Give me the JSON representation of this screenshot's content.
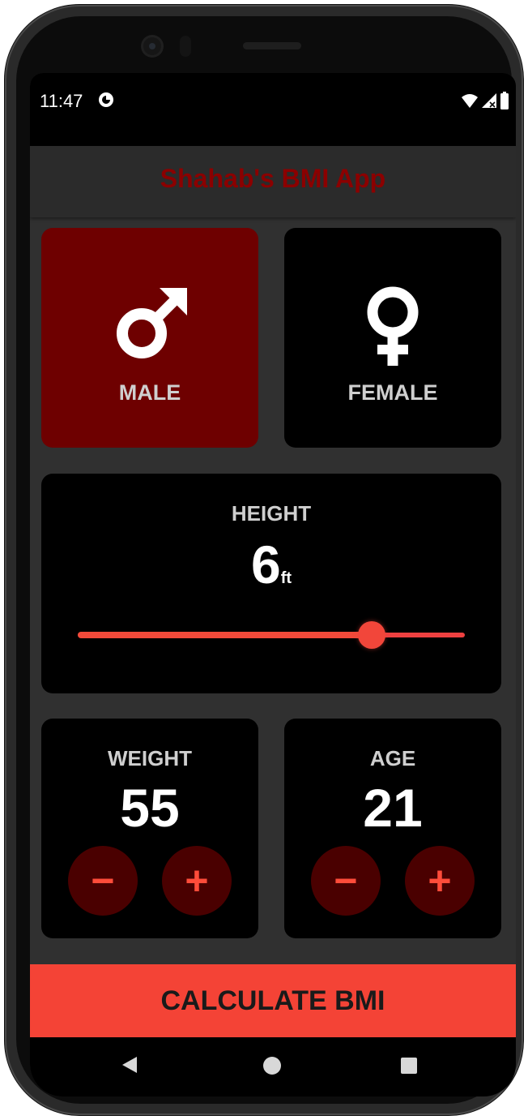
{
  "status_bar": {
    "time": "11:47",
    "icons": [
      "app-notification-icon",
      "wifi-icon",
      "cellular-signal-icon",
      "battery-icon"
    ]
  },
  "app_bar": {
    "title": "Shahab's BMI App",
    "title_color": "#8b0000"
  },
  "gender": {
    "male_label": "MALE",
    "female_label": "FEMALE",
    "selected": "male",
    "selected_color": "#6e0000",
    "inactive_color": "#000000"
  },
  "height": {
    "label": "HEIGHT",
    "value": "6",
    "unit": "ft",
    "slider_fraction": 0.76,
    "slider_color": "#f44336"
  },
  "weight": {
    "label": "WEIGHT",
    "value": "55",
    "minus_label": "−",
    "plus_label": "+"
  },
  "age": {
    "label": "AGE",
    "value": "21",
    "minus_label": "−",
    "plus_label": "+"
  },
  "calculate": {
    "label": "CALCULATE BMI",
    "color": "#f44336"
  },
  "nav_bar": {
    "icons": [
      "back-icon",
      "home-icon",
      "recents-icon"
    ]
  }
}
